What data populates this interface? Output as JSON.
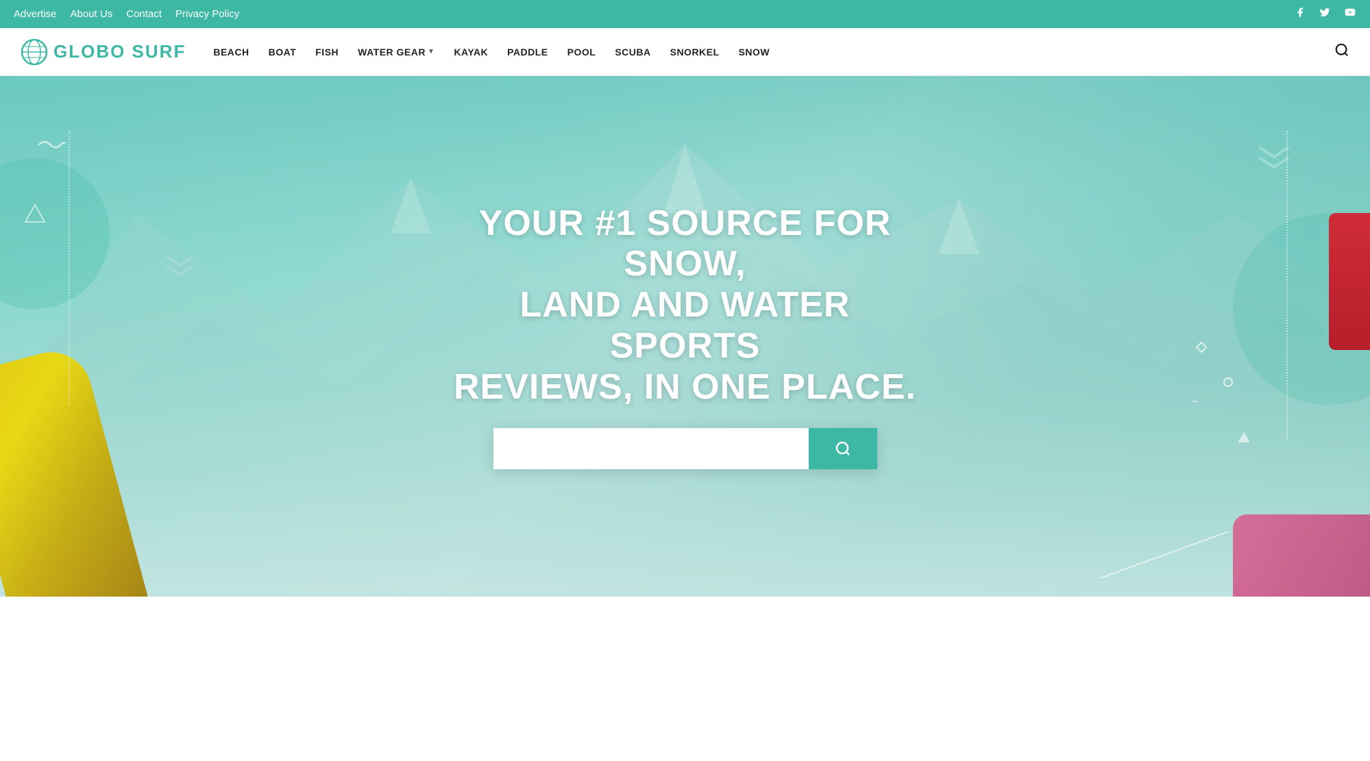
{
  "topbar": {
    "links": [
      {
        "label": "Advertise",
        "id": "advertise"
      },
      {
        "label": "About Us",
        "id": "about-us"
      },
      {
        "label": "Contact",
        "id": "contact"
      },
      {
        "label": "Privacy Policy",
        "id": "privacy-policy"
      }
    ],
    "social": [
      {
        "id": "facebook",
        "icon": "f",
        "label": "Facebook"
      },
      {
        "id": "twitter",
        "icon": "t",
        "label": "Twitter"
      },
      {
        "id": "youtube",
        "icon": "y",
        "label": "YouTube"
      }
    ]
  },
  "nav": {
    "logo_text": "GLOBO SURF",
    "items": [
      {
        "label": "BEACH",
        "id": "beach",
        "hasDropdown": false
      },
      {
        "label": "BOAT",
        "id": "boat",
        "hasDropdown": false
      },
      {
        "label": "FISH",
        "id": "fish",
        "hasDropdown": false
      },
      {
        "label": "WATER GEAR",
        "id": "water-gear",
        "hasDropdown": true
      },
      {
        "label": "KAYAK",
        "id": "kayak",
        "hasDropdown": false
      },
      {
        "label": "PADDLE",
        "id": "paddle",
        "hasDropdown": false
      },
      {
        "label": "POOL",
        "id": "pool",
        "hasDropdown": false
      },
      {
        "label": "SCUBA",
        "id": "scuba",
        "hasDropdown": false
      },
      {
        "label": "SNORKEL",
        "id": "snorkel",
        "hasDropdown": false
      },
      {
        "label": "SNOW",
        "id": "snow",
        "hasDropdown": false
      }
    ]
  },
  "hero": {
    "headline_line1": "YOUR #1 SOURCE FOR SNOW,",
    "headline_line2": "LAND AND WATER SPORTS",
    "headline_line3": "REVIEWS, IN ONE PLACE.",
    "search_placeholder": "",
    "search_button_label": "🔍"
  },
  "colors": {
    "teal": "#3db8a5",
    "teal_dark": "#35a090",
    "white": "#ffffff",
    "nav_text": "#222222"
  }
}
